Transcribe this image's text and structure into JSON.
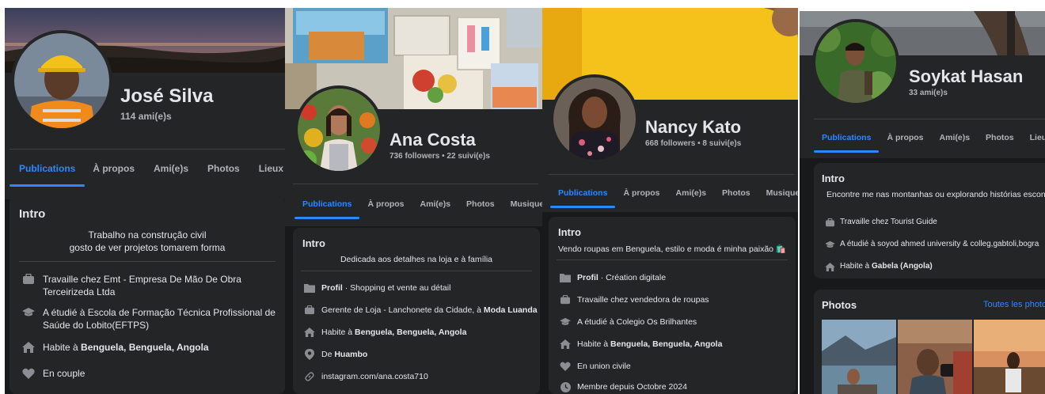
{
  "profiles": [
    {
      "name": "José Silva",
      "subtitle": "114 ami(e)s",
      "tabs": [
        "Publications",
        "À propos",
        "Ami(e)s",
        "Photos",
        "Lieux"
      ],
      "intro_title": "Intro",
      "bio_lines": [
        "Trabalho na construção civil",
        "gosto de ver projetos tomarem forma"
      ],
      "items": [
        {
          "icon": "briefcase-icon",
          "prefix": "Travaille chez Emt - Empresa De Mão De Obra Terceirizeda Ltda",
          "bold": ""
        },
        {
          "icon": "graduation-cap-icon",
          "prefix": "A étudié à Escola de Formação Técnica Profissional de Saúde do Lobito(EFTPS)",
          "bold": ""
        },
        {
          "icon": "home-icon",
          "prefix": "Habite à ",
          "bold": "Benguela, Benguela, Angola"
        },
        {
          "icon": "heart-icon",
          "prefix": "En couple",
          "bold": ""
        }
      ]
    },
    {
      "name": "Ana Costa",
      "subtitle": "736 followers • 22 suivi(e)s",
      "tabs": [
        "Publications",
        "À propos",
        "Ami(e)s",
        "Photos",
        "Musique"
      ],
      "intro_title": "Intro",
      "bio_lines": [
        "Dedicada aos detalhes na loja e à família"
      ],
      "items": [
        {
          "icon": "folder-icon",
          "bold_first": "Profil",
          "rest": " · Shopping et vente au détail"
        },
        {
          "icon": "briefcase-icon",
          "prefix": "Gerente de Loja - Lanchonete da Cidade, à ",
          "bold": "Moda Luanda"
        },
        {
          "icon": "home-icon",
          "prefix": "Habite à ",
          "bold": "Benguela, Benguela, Angola"
        },
        {
          "icon": "location-pin-icon",
          "prefix": "De ",
          "bold": "Huambo"
        },
        {
          "icon": "link-icon",
          "prefix": "instagram.com/ana.costa710",
          "bold": ""
        }
      ]
    },
    {
      "name": "Nancy Kato",
      "subtitle": "668 followers • 8 suivi(e)s",
      "tabs": [
        "Publications",
        "À propos",
        "Ami(e)s",
        "Photos",
        "Musique"
      ],
      "intro_title": "Intro",
      "bio_lines": [
        "Vendo roupas em Benguela, estilo e moda é minha paixão 🛍️"
      ],
      "items": [
        {
          "icon": "folder-icon",
          "bold_first": "Profil",
          "rest": " · Création digitale"
        },
        {
          "icon": "briefcase-icon",
          "prefix": "Travaille chez vendedora de roupas",
          "bold": ""
        },
        {
          "icon": "graduation-cap-icon",
          "prefix": "A étudié à Colegio Os Brilhantes",
          "bold": ""
        },
        {
          "icon": "home-icon",
          "prefix": "Habite à ",
          "bold": "Benguela, Benguela, Angola"
        },
        {
          "icon": "heart-icon",
          "prefix": "En union civile",
          "bold": ""
        },
        {
          "icon": "clock-icon",
          "prefix": "Membre depuis Octobre 2024",
          "bold": ""
        }
      ]
    },
    {
      "name": "Soykat Hasan",
      "subtitle": "33 ami(e)s",
      "tabs": [
        "Publications",
        "À propos",
        "Ami(e)s",
        "Photos",
        "Lieux"
      ],
      "intro_title": "Intro",
      "bio_lines": [
        "Encontre me nas montanhas ou explorando histórias escondidas"
      ],
      "items": [
        {
          "icon": "briefcase-icon",
          "prefix": "Travaille chez Tourist Guide",
          "bold": ""
        },
        {
          "icon": "graduation-cap-icon",
          "prefix": "A étudié à soyod ahmed university & colleg,gabtoli,bogra",
          "bold": ""
        },
        {
          "icon": "home-icon",
          "prefix": "Habite à ",
          "bold": "Gabela (Angola)"
        }
      ],
      "photos_title": "Photos",
      "photos_link": "Toutes les photos"
    }
  ],
  "colors": {
    "background": "#18191a",
    "card": "#242526",
    "accent": "#2d88ff",
    "text": "#e4e6eb",
    "muted": "#b0b3b8"
  }
}
